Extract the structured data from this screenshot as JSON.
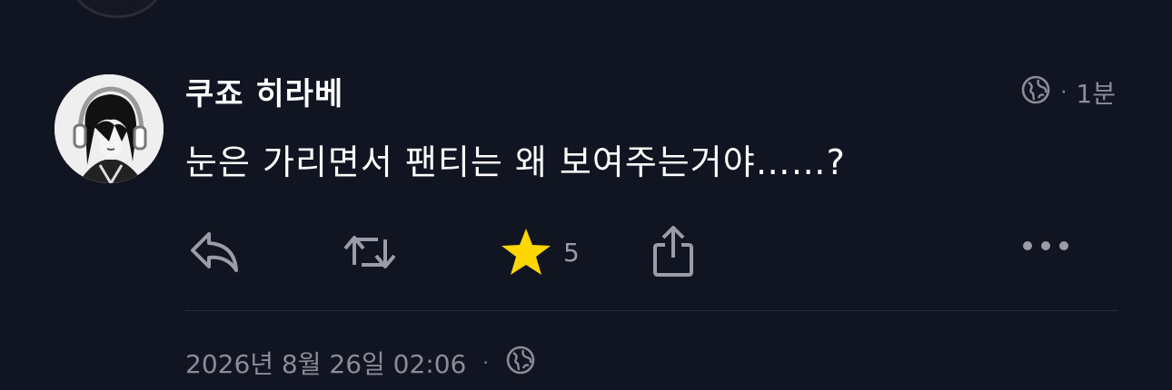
{
  "post": {
    "author": "쿠죠 히라베",
    "time": "1분",
    "text": "눈은 가리면서 팬티는 왜 보여주는거야……?"
  },
  "actions": {
    "favorite_count": "5"
  },
  "footer": {
    "timestamp": "2026년 8월 26일 02:06",
    "separator": "·"
  },
  "meta": {
    "separator": "·"
  },
  "icons": {
    "visibility": "globe-icon",
    "reply": "reply-icon",
    "boost": "boost-icon",
    "favorite": "star-icon",
    "share": "share-icon",
    "more": "more-icon"
  },
  "colors": {
    "background": "#111421",
    "muted": "#8a8d99",
    "star": "#ffd700"
  }
}
